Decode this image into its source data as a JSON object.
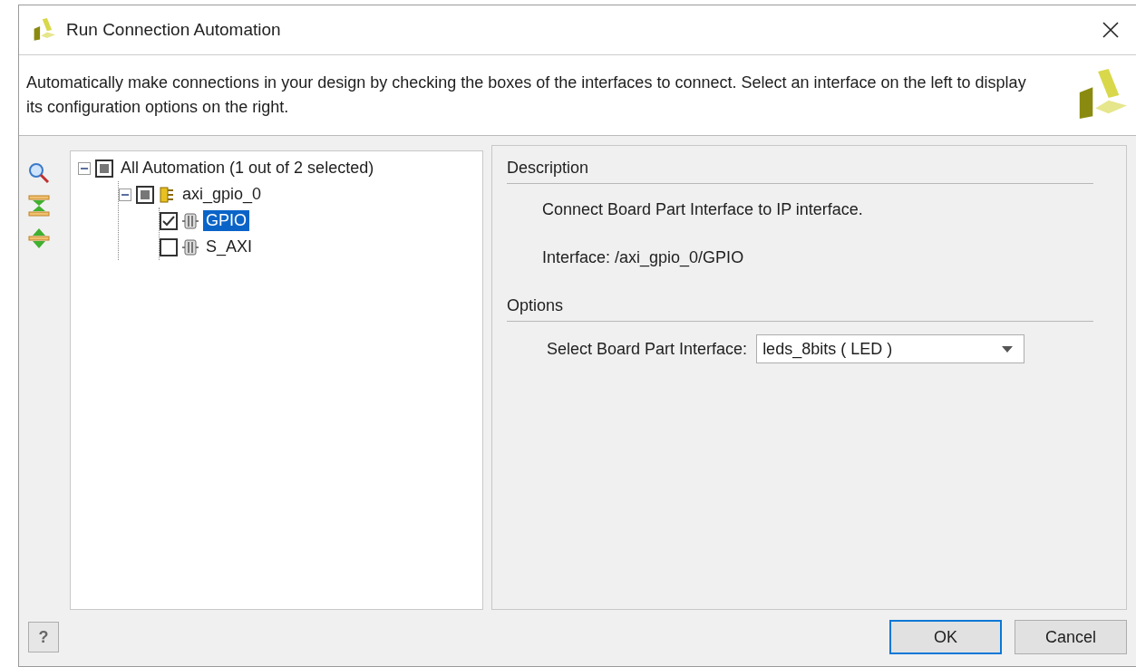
{
  "window": {
    "title": "Run Connection Automation"
  },
  "intro": "Automatically make connections in your design by checking the boxes of the interfaces to connect. Select an interface on the left to display its configuration options on the right.",
  "tree": [
    {
      "label": "All Automation (1 out of 2 selected)",
      "partial": true,
      "expanded": true,
      "selected": false,
      "children": [
        {
          "label": "axi_gpio_0",
          "kind": "ip",
          "partial": true,
          "expanded": true,
          "selected": false,
          "children": [
            {
              "label": "GPIO",
              "kind": "interface",
              "checked": true,
              "selected": true
            },
            {
              "label": "S_AXI",
              "kind": "interface",
              "checked": false,
              "selected": false
            }
          ]
        }
      ]
    }
  ],
  "details": {
    "description_heading": "Description",
    "description": "Connect Board Part Interface to IP interface.",
    "interface": "Interface: /axi_gpio_0/GPIO",
    "options_heading": "Options",
    "option_label": "Select Board Part Interface:",
    "option_value": "leds_8bits ( LED )"
  },
  "buttons": [
    {
      "label": "OK",
      "default": true
    },
    {
      "label": "Cancel",
      "default": false
    }
  ],
  "help": "?"
}
